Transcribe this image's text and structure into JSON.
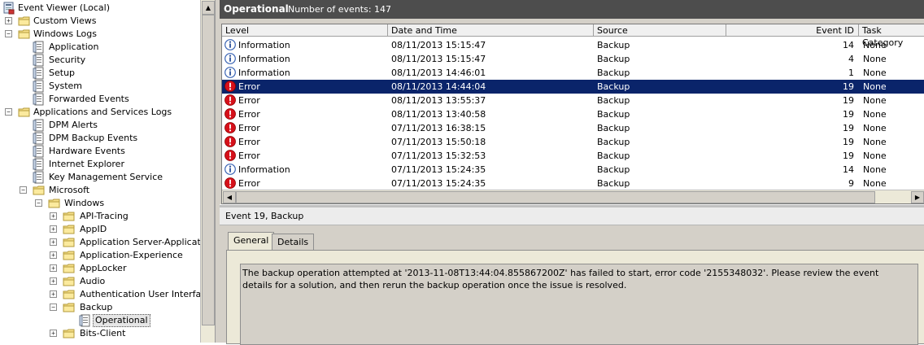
{
  "tree": {
    "nodes": [
      {
        "label": "Event Viewer (Local)",
        "icon": "computer-icon",
        "expander": "-"
      },
      {
        "label": "Custom Views",
        "icon": "folder-icon",
        "expander": "+"
      },
      {
        "label": "Windows Logs",
        "icon": "folder-icon",
        "expander": "-"
      },
      {
        "label": "Application",
        "icon": "log-icon",
        "expander": ""
      },
      {
        "label": "Security",
        "icon": "log-icon",
        "expander": ""
      },
      {
        "label": "Setup",
        "icon": "log-icon",
        "expander": ""
      },
      {
        "label": "System",
        "icon": "log-icon",
        "expander": ""
      },
      {
        "label": "Forwarded Events",
        "icon": "log-icon",
        "expander": ""
      },
      {
        "label": "Applications and Services Logs",
        "icon": "folder-icon",
        "expander": "-"
      },
      {
        "label": "DPM Alerts",
        "icon": "log-icon",
        "expander": ""
      },
      {
        "label": "DPM Backup Events",
        "icon": "log-icon",
        "expander": ""
      },
      {
        "label": "Hardware Events",
        "icon": "log-icon",
        "expander": ""
      },
      {
        "label": "Internet Explorer",
        "icon": "log-icon",
        "expander": ""
      },
      {
        "label": "Key Management Service",
        "icon": "log-icon",
        "expander": ""
      },
      {
        "label": "Microsoft",
        "icon": "folder-icon",
        "expander": "-"
      },
      {
        "label": "Windows",
        "icon": "folder-icon",
        "expander": "-"
      },
      {
        "label": "API-Tracing",
        "icon": "folder-icon",
        "expander": "+"
      },
      {
        "label": "AppID",
        "icon": "folder-icon",
        "expander": "+"
      },
      {
        "label": "Application Server-Applications",
        "icon": "folder-icon",
        "expander": "+"
      },
      {
        "label": "Application-Experience",
        "icon": "folder-icon",
        "expander": "+"
      },
      {
        "label": "AppLocker",
        "icon": "folder-icon",
        "expander": "+"
      },
      {
        "label": "Audio",
        "icon": "folder-icon",
        "expander": "+"
      },
      {
        "label": "Authentication User Interface",
        "icon": "folder-icon",
        "expander": "+"
      },
      {
        "label": "Backup",
        "icon": "folder-icon",
        "expander": "-"
      },
      {
        "label": "Operational",
        "icon": "log-icon",
        "expander": ""
      },
      {
        "label": "Bits-Client",
        "icon": "folder-icon",
        "expander": "+"
      }
    ]
  },
  "log_header": {
    "name": "Operational",
    "count_label": "Number of events: 147"
  },
  "grid": {
    "columns": [
      "Level",
      "Date and Time",
      "Source",
      "Event ID",
      "Task Category"
    ],
    "rows": [
      {
        "level": "Information",
        "icon": "info-icon",
        "datetime": "08/11/2013 15:15:47",
        "source": "Backup",
        "event_id": "14",
        "category": "None"
      },
      {
        "level": "Information",
        "icon": "info-icon",
        "datetime": "08/11/2013 15:15:47",
        "source": "Backup",
        "event_id": "4",
        "category": "None"
      },
      {
        "level": "Information",
        "icon": "info-icon",
        "datetime": "08/11/2013 14:46:01",
        "source": "Backup",
        "event_id": "1",
        "category": "None"
      },
      {
        "level": "Error",
        "icon": "error-icon",
        "datetime": "08/11/2013 14:44:04",
        "source": "Backup",
        "event_id": "19",
        "category": "None",
        "selected": true
      },
      {
        "level": "Error",
        "icon": "error-icon",
        "datetime": "08/11/2013 13:55:37",
        "source": "Backup",
        "event_id": "19",
        "category": "None"
      },
      {
        "level": "Error",
        "icon": "error-icon",
        "datetime": "08/11/2013 13:40:58",
        "source": "Backup",
        "event_id": "19",
        "category": "None"
      },
      {
        "level": "Error",
        "icon": "error-icon",
        "datetime": "07/11/2013 16:38:15",
        "source": "Backup",
        "event_id": "19",
        "category": "None"
      },
      {
        "level": "Error",
        "icon": "error-icon",
        "datetime": "07/11/2013 15:50:18",
        "source": "Backup",
        "event_id": "19",
        "category": "None"
      },
      {
        "level": "Error",
        "icon": "error-icon",
        "datetime": "07/11/2013 15:32:53",
        "source": "Backup",
        "event_id": "19",
        "category": "None"
      },
      {
        "level": "Information",
        "icon": "info-icon",
        "datetime": "07/11/2013 15:24:35",
        "source": "Backup",
        "event_id": "14",
        "category": "None"
      },
      {
        "level": "Error",
        "icon": "error-icon",
        "datetime": "07/11/2013 15:24:35",
        "source": "Backup",
        "event_id": "9",
        "category": "None"
      }
    ]
  },
  "detail": {
    "title": "Event 19, Backup",
    "tabs": [
      "General",
      "Details"
    ],
    "description": "The backup operation attempted at '2013-11-08T13:44:04.855867200Z' has failed to start, error code '2155348032'. Please review the event details for a solution, and then rerun the backup operation once the issue is resolved."
  },
  "colors": {
    "selection": "#0a246a",
    "header_bar": "#4d4d4d",
    "error_red": "#d6101a",
    "info_blue": "#3a64b4"
  }
}
